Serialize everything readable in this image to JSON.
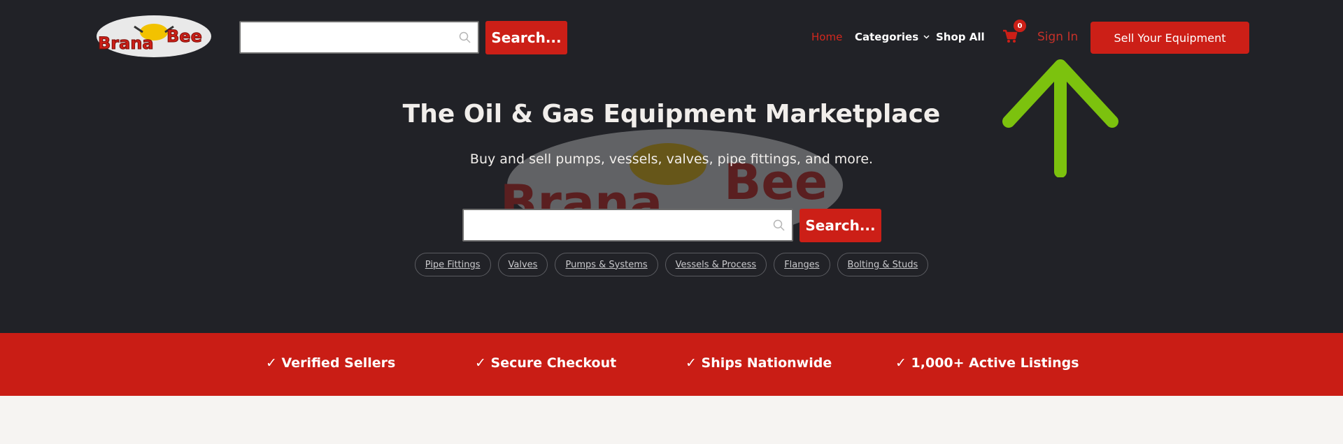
{
  "header": {
    "logo_text": "Brana Bee",
    "search": {
      "placeholder": "",
      "button_label": "Search..."
    },
    "nav": {
      "home": "Home",
      "categories": "Categories",
      "shop_all": "Shop All",
      "cart_count": "0",
      "sign_in": "Sign In",
      "sell_button": "Sell Your Equipment"
    }
  },
  "hero": {
    "title": "The Oil & Gas Equipment Marketplace",
    "subtitle": "Buy and sell pumps, vessels, valves, pipe fittings, and more.",
    "search": {
      "placeholder": "",
      "button_label": "Search..."
    },
    "chips": [
      "Pipe Fittings",
      "Valves",
      "Pumps & Systems",
      "Vessels & Process",
      "Flanges",
      "Bolting & Studs"
    ]
  },
  "features": [
    "✓ Verified Sellers",
    "✓ Secure Checkout",
    "✓ Ships Nationwide",
    "✓ 1,000+ Active Listings"
  ],
  "colors": {
    "dark_bg": "#212227",
    "brand_red": "#cc1f17",
    "annotation_green": "#7cc20e",
    "page_bg": "#f6f4f2"
  }
}
